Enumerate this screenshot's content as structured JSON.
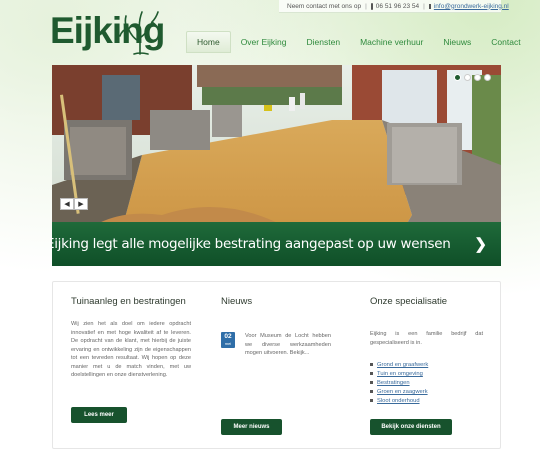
{
  "header": {
    "logo_text": "Eijking",
    "contact": {
      "intro": "Neem contact met ons op",
      "phone": "06 51 96 23 54",
      "email": "info@grondwerk-eijking.nl"
    }
  },
  "nav": {
    "items": [
      {
        "label": "Home",
        "active": true
      },
      {
        "label": "Over Eijking",
        "active": false
      },
      {
        "label": "Diensten",
        "active": false
      },
      {
        "label": "Machine verhuur",
        "active": false
      },
      {
        "label": "Nieuws",
        "active": false
      },
      {
        "label": "Contact",
        "active": false
      }
    ]
  },
  "slider": {
    "caption": "Eijking legt alle mogelijke bestrating aangepast op uw wensen",
    "dot_count": 4,
    "active_dot": 1,
    "prev_icon": "chevron-left-icon",
    "next_icon": "chevron-right-icon"
  },
  "columns": {
    "left": {
      "title": "Tuinaanleg en bestratingen",
      "text": "Wij zien het als doel om iedere opdracht innovatief en met hoge kwaliteit af te leveren. De opdracht van de klant, met hierbij de juiste ervaring en ontwikkeling zijn de eigenschappen tot een tevreden resultaat. Wij hopen op deze manier met u de match vinden, met uw doelstellingen en onze dienstverlening.",
      "button": "Lees meer"
    },
    "middle": {
      "title": "Nieuws",
      "date_day": "02",
      "date_month": "mei",
      "text": "Voor Museum de Locht hebben we diverse werkzaamheden mogen uitvoeren. Bekijk...",
      "button": "Meer nieuws"
    },
    "right": {
      "title": "Onze specialisatie",
      "text": "Eijking is een familie bedrijf dat gespecialiseerd is in.",
      "items": [
        "Grond en graafwerk",
        "Tuin en omgeving",
        "Bestratingen",
        "Groen en zaagwerk",
        "Sloot onderhoud"
      ],
      "button": "Bekijk onze diensten"
    }
  },
  "colors": {
    "brand_dark_green": "#1f5a2f",
    "nav_green": "#2f8a3d",
    "caption_green": "#0f4f28",
    "link_blue": "#3a6b9c"
  }
}
